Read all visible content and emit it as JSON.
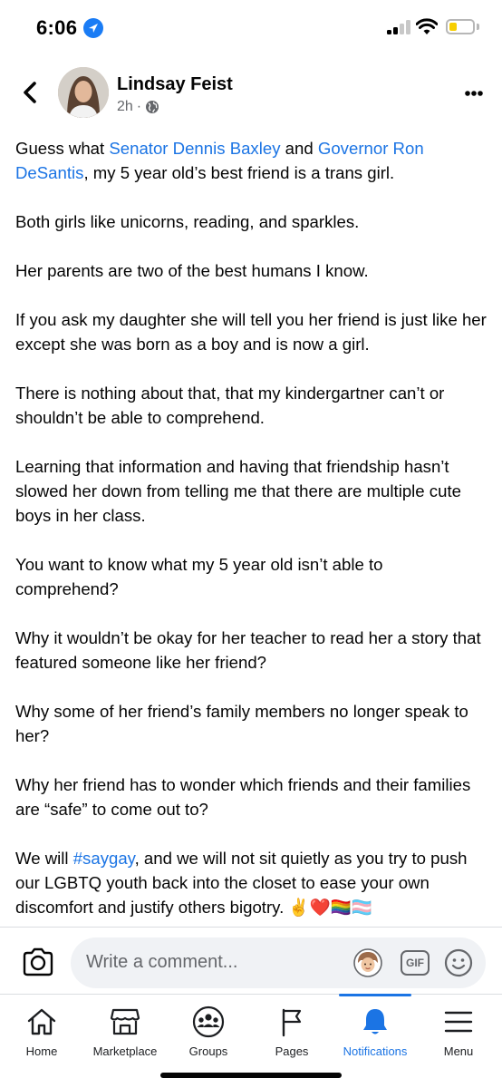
{
  "status_bar": {
    "time": "6:06",
    "battery_level": 0.35,
    "battery_color": "#f7ce00"
  },
  "header": {
    "back_icon": "chevron-left-icon",
    "author_name": "Lindsay Feist",
    "timestamp": "2h",
    "separator": "·",
    "privacy_icon": "globe-icon",
    "more_icon": "more-horizontal-icon"
  },
  "post": {
    "p1": {
      "pre": "Guess what ",
      "link1": "Senator Dennis Baxley",
      "mid": " and ",
      "link2": "Governor Ron DeSantis",
      "post": ", my 5 year old’s best friend is a trans girl."
    },
    "p2": "Both girls like unicorns, reading, and sparkles.",
    "p3": "Her parents are two of the best humans I know.",
    "p4": "If you ask my daughter she will tell you her friend is just like her except she was born as a boy and is now a girl.",
    "p5": "There is nothing about that, that my kindergartner can’t or shouldn’t be able to comprehend.",
    "p6": "Learning that information and having that friendship hasn’t slowed her down from telling me that there are multiple cute boys in her class.",
    "p7": "You want to know what my 5 year old isn’t able to comprehend?",
    "p8": "Why it wouldn’t be okay for her teacher to read her a story that featured someone like her friend?",
    "p9": "Why some of her friend’s family members no longer speak to her?",
    "p10": "Why her friend has to wonder which friends and their families are “safe” to come out to?",
    "p11": {
      "pre": "We will ",
      "hashtag": "#saygay",
      "post": ", and we will not sit quietly as you try to push our LGBTQ youth back into the closet to ease your own discomfort and justify others bigotry. ",
      "emojis": "✌️❤️🏳️‍🌈🏳️‍⚧️"
    }
  },
  "comment_bar": {
    "camera_icon": "camera-icon",
    "placeholder": "Write a comment...",
    "avatar_icon": "avatar-sticker-icon",
    "gif_label": "GIF",
    "emoji_icon": "smiley-icon"
  },
  "tabs": [
    {
      "label": "Home",
      "icon": "home-icon"
    },
    {
      "label": "Marketplace",
      "icon": "marketplace-icon"
    },
    {
      "label": "Groups",
      "icon": "groups-icon"
    },
    {
      "label": "Pages",
      "icon": "flag-icon"
    },
    {
      "label": "Notifications",
      "icon": "bell-icon",
      "active": true
    },
    {
      "label": "Menu",
      "icon": "menu-icon"
    }
  ],
  "colors": {
    "link": "#1b74e4",
    "text": "#050505",
    "secondary": "#65676b",
    "location_badge": "#1a7cf5"
  }
}
